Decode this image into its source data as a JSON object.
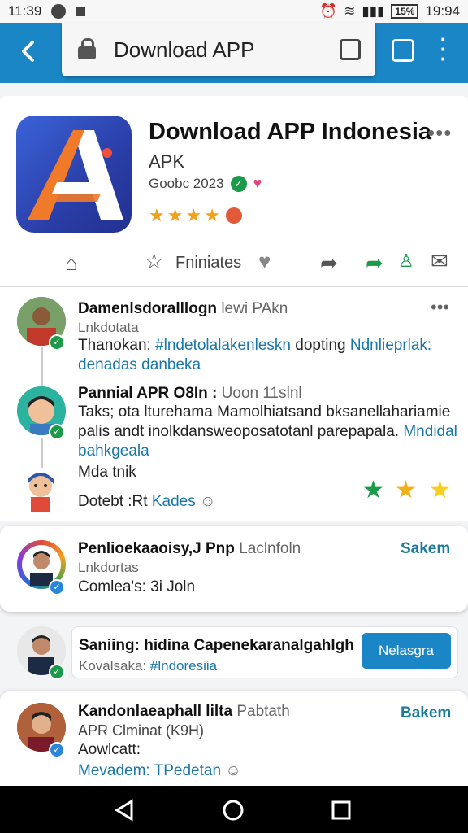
{
  "status": {
    "time_left": "11:39",
    "battery": "15%",
    "time_right": "19:94"
  },
  "toolbar": {
    "url_title": "Download APP"
  },
  "app": {
    "title": "Download APP Indonesia",
    "subtitle": "APK",
    "meta": "Goobc 2023",
    "rating_stars": 4,
    "favorites_label": "Fniniates",
    "icon_letter": "A"
  },
  "posts": [
    {
      "name": "Damenlsdoralllogn",
      "name_muted": "lewi PAkn",
      "sub": "Lnkdotata",
      "text_prefix": "Thanokan: ",
      "text_link": "#lndetolalakenleskn",
      "text_mid": " dopting ",
      "text_tail_link": "Ndnlieprlak:",
      "text_line2": "denadas danbeka"
    },
    {
      "name": "Pannial APR O8In :",
      "name_muted": "Uoon 11slnl",
      "line1": "Taks; ota lturehama Mamolhiatsand bksanellahariamie",
      "line2_text": "palis andt inolkdansweoposatotanl parepapala. ",
      "line2_link": "Mndidal",
      "line3_link": "bahkgeala",
      "extra": "Mda tnik",
      "footer_text": "Dotebt :Rt ",
      "footer_link": "Kades"
    },
    {
      "name": "Penlioekaaoisy,J Pnp",
      "name_muted": "Laclnfoln",
      "sub": "Lnkdortas",
      "text": "Comlea's: 3i Joln",
      "action": "Sakem"
    },
    {
      "name": "Kandonlaeaphall lilta",
      "name_muted": "Pabtath",
      "sub": "APR Clminat (K9H)",
      "text": "Aowlcatt:",
      "footer_link_label": "Mevadem:",
      "footer_link": "TPedetan",
      "action": "Bakem"
    }
  ],
  "compose": {
    "line1": "Saniing: hidina Capenekaranalgahlgh",
    "line2_prefix": "Kovalsaka: ",
    "line2_link": "#lndoresiia",
    "send_label": "Nelasgra"
  },
  "colors": {
    "appbar": "#1a86c6",
    "link": "#1876a8",
    "star": "#f2a21a",
    "verified": "#1b9b49"
  }
}
